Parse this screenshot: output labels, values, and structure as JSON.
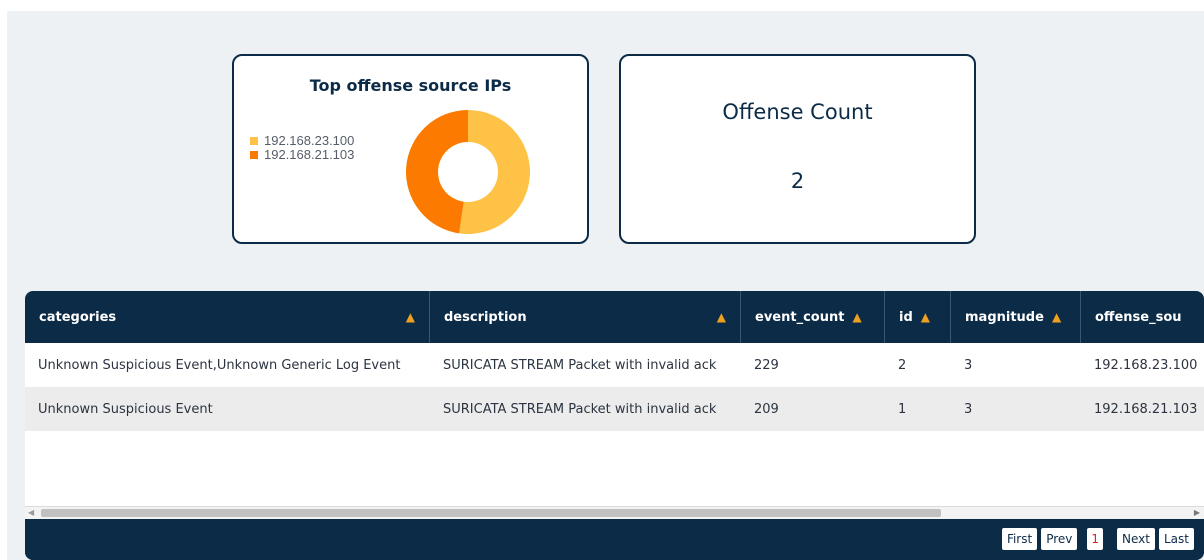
{
  "pie_card": {
    "title": "Top offense source IPs",
    "legend": [
      {
        "label": "192.168.23.100",
        "color": "#fdc246"
      },
      {
        "label": "192.168.21.103",
        "color": "#fc7a00"
      }
    ],
    "chart_data": {
      "type": "pie",
      "categories": [
        "192.168.23.100",
        "192.168.21.103"
      ],
      "values": [
        229,
        209
      ],
      "colors": [
        "#fdc246",
        "#fc7a00"
      ],
      "donut": true,
      "legend_position": "left"
    }
  },
  "count_card": {
    "title": "Offense Count",
    "value": "2"
  },
  "table": {
    "columns": [
      {
        "label": "categories"
      },
      {
        "label": "description"
      },
      {
        "label": "event_count"
      },
      {
        "label": "id"
      },
      {
        "label": "magnitude"
      },
      {
        "label": "offense_sou"
      }
    ],
    "rows": [
      [
        "Unknown Suspicious Event,Unknown Generic Log Event",
        "SURICATA STREAM Packet with invalid ack",
        "229",
        "2",
        "3",
        "192.168.23.100"
      ],
      [
        "Unknown Suspicious Event",
        "SURICATA STREAM Packet with invalid ack",
        "209",
        "1",
        "3",
        "192.168.21.103"
      ]
    ],
    "sort_icon": "▲"
  },
  "pagination": {
    "first": "First",
    "prev": "Prev",
    "current": "1",
    "next": "Next",
    "last": "Last"
  },
  "colors": {
    "navy": "#0c2b47",
    "sort_arrow": "#f0a020",
    "page_background": "#eef1f4"
  }
}
